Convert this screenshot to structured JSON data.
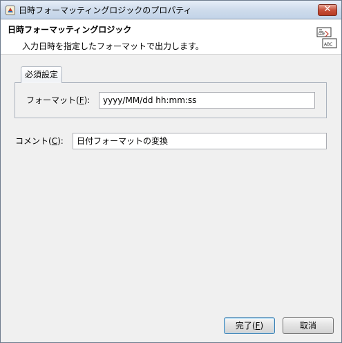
{
  "window": {
    "title": "日時フォーマッティングロジックのプロパティ",
    "close_label": "✕"
  },
  "header": {
    "title": "日時フォーマッティングロジック",
    "description": "入力日時を指定したフォーマットで出力します。",
    "icon_text_top": "GRE",
    "icon_text_bottom": "ABC"
  },
  "tabs": [
    {
      "label": "必須設定"
    }
  ],
  "format": {
    "label_prefix": "フォーマット(",
    "mnemonic": "F",
    "label_suffix": "):",
    "value": "yyyy/MM/dd hh:mm:ss"
  },
  "comment": {
    "label_prefix": "コメント(",
    "mnemonic": "C",
    "label_suffix": "):",
    "value": "日付フォーマットの変換"
  },
  "buttons": {
    "finish_prefix": "完了(",
    "finish_mnemonic": "F",
    "finish_suffix": ")",
    "cancel": "取消"
  }
}
